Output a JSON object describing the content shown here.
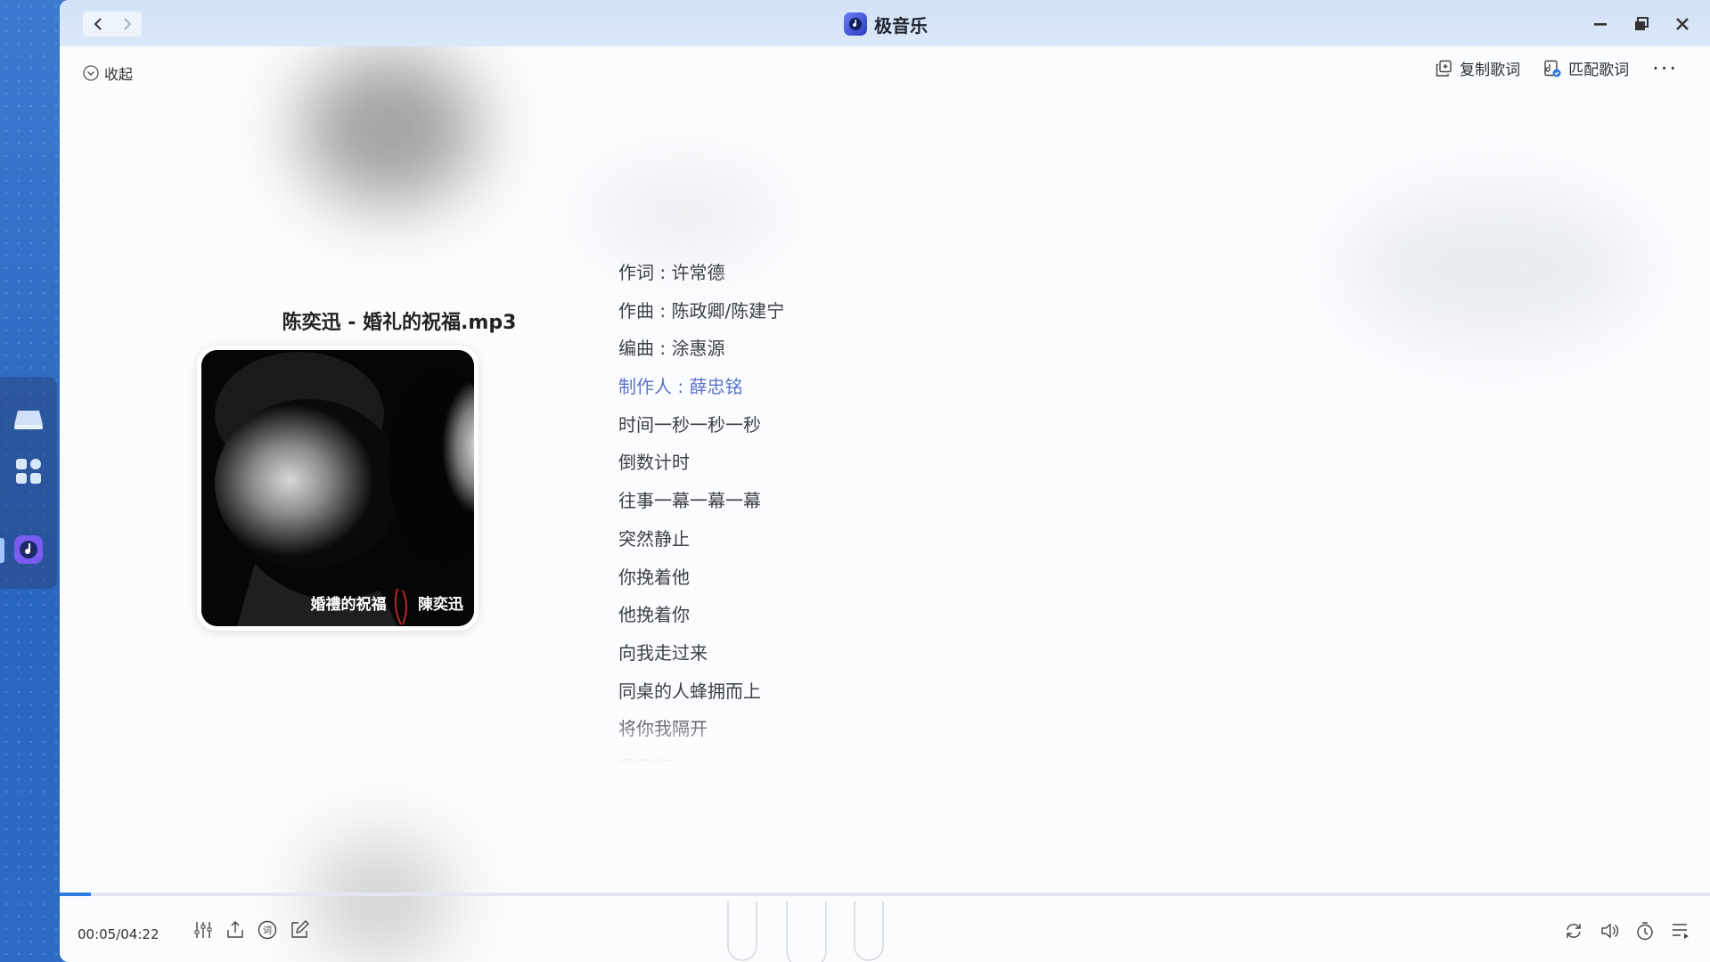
{
  "app": {
    "title": "极音乐"
  },
  "header": {
    "collapse_label": "收起",
    "copy_lyrics_label": "复制歌词",
    "match_lyrics_label": "匹配歌词",
    "more_label": "···"
  },
  "song": {
    "title": "陈奕迅 - 婚礼的祝福.mp3",
    "cover_caption_left": "婚禮的祝福",
    "cover_caption_right": "陳奕迅"
  },
  "lyrics": [
    "作词 : 许常德",
    "作曲 : 陈政卿/陈建宁",
    "编曲 : 涂惠源",
    "制作人 : 薛忠铭",
    "时间一秒一秒一秒",
    "倒数计时",
    "往事一幕一幕一幕",
    "突然静止",
    "你挽着他",
    "他挽着你",
    "向我走过来",
    "同桌的人蜂拥而上",
    "将你我隔开",
    "我干杯"
  ],
  "active_lyric_index": 3,
  "player": {
    "time": "00:05/04:22",
    "progress_fraction": 0.019
  },
  "colors": {
    "accent": "#2d7be6",
    "active_lyric": "#5a73c9"
  }
}
